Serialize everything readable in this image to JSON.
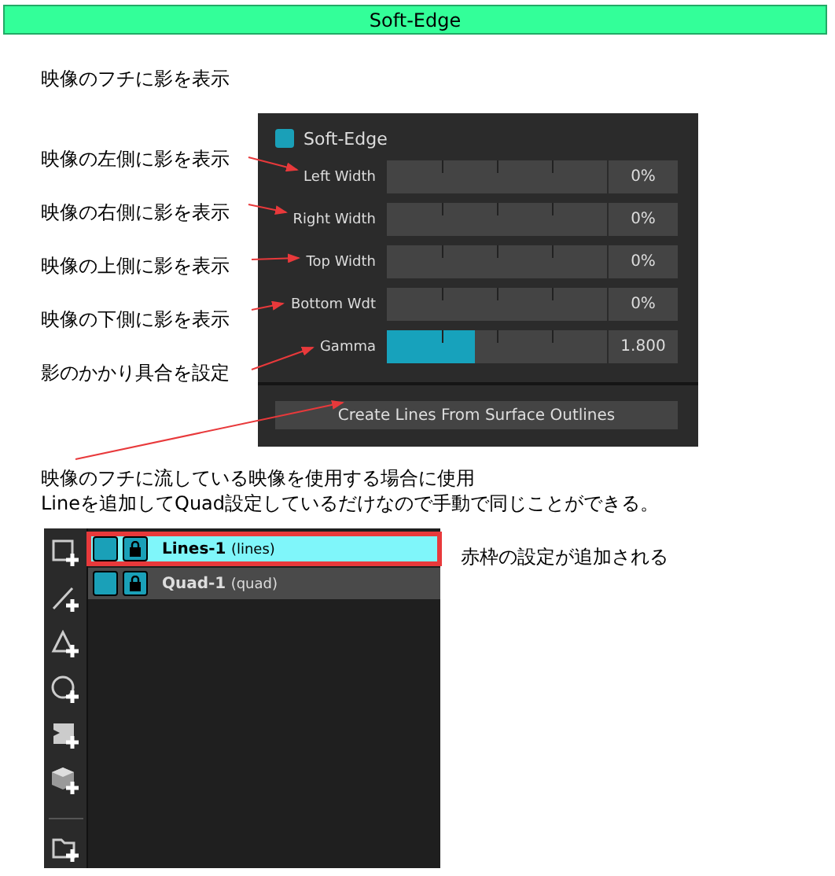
{
  "header": {
    "title": "Soft-Edge"
  },
  "intro": "映像のフチに影を表示",
  "notes": [
    "映像の左側に影を表示",
    "映像の右側に影を表示",
    "映像の上側に影を表示",
    "映像の下側に影を表示",
    "影のかかり具合を設定"
  ],
  "panel": {
    "toggle": {
      "label": "Soft-Edge",
      "checked": true
    },
    "sliders": [
      {
        "label": "Left Width",
        "reading": "0%"
      },
      {
        "label": "Right Width",
        "reading": "0%"
      },
      {
        "label": "Top Width",
        "reading": "0%"
      },
      {
        "label": "Bottom Wdt",
        "reading": "0%"
      },
      {
        "label": "Gamma",
        "level": 0.4,
        "reading": "1.800"
      }
    ],
    "button": "Create Lines From Surface Outlines"
  },
  "explanation": [
    "映像のフチに流している映像を使用する場合に使用",
    "Lineを追加してQuad設定しているだけなので手動で同じことができる。"
  ],
  "layers": [
    {
      "name": "Lines-1",
      "type": "(lines)",
      "selected": true,
      "outlined": true,
      "visible": true,
      "locked": true
    },
    {
      "name": "Quad-1",
      "type": "(quad)",
      "selected": false,
      "outlined": false,
      "visible": true,
      "locked": true
    }
  ],
  "layers_note": "赤枠の設定が追加される"
}
